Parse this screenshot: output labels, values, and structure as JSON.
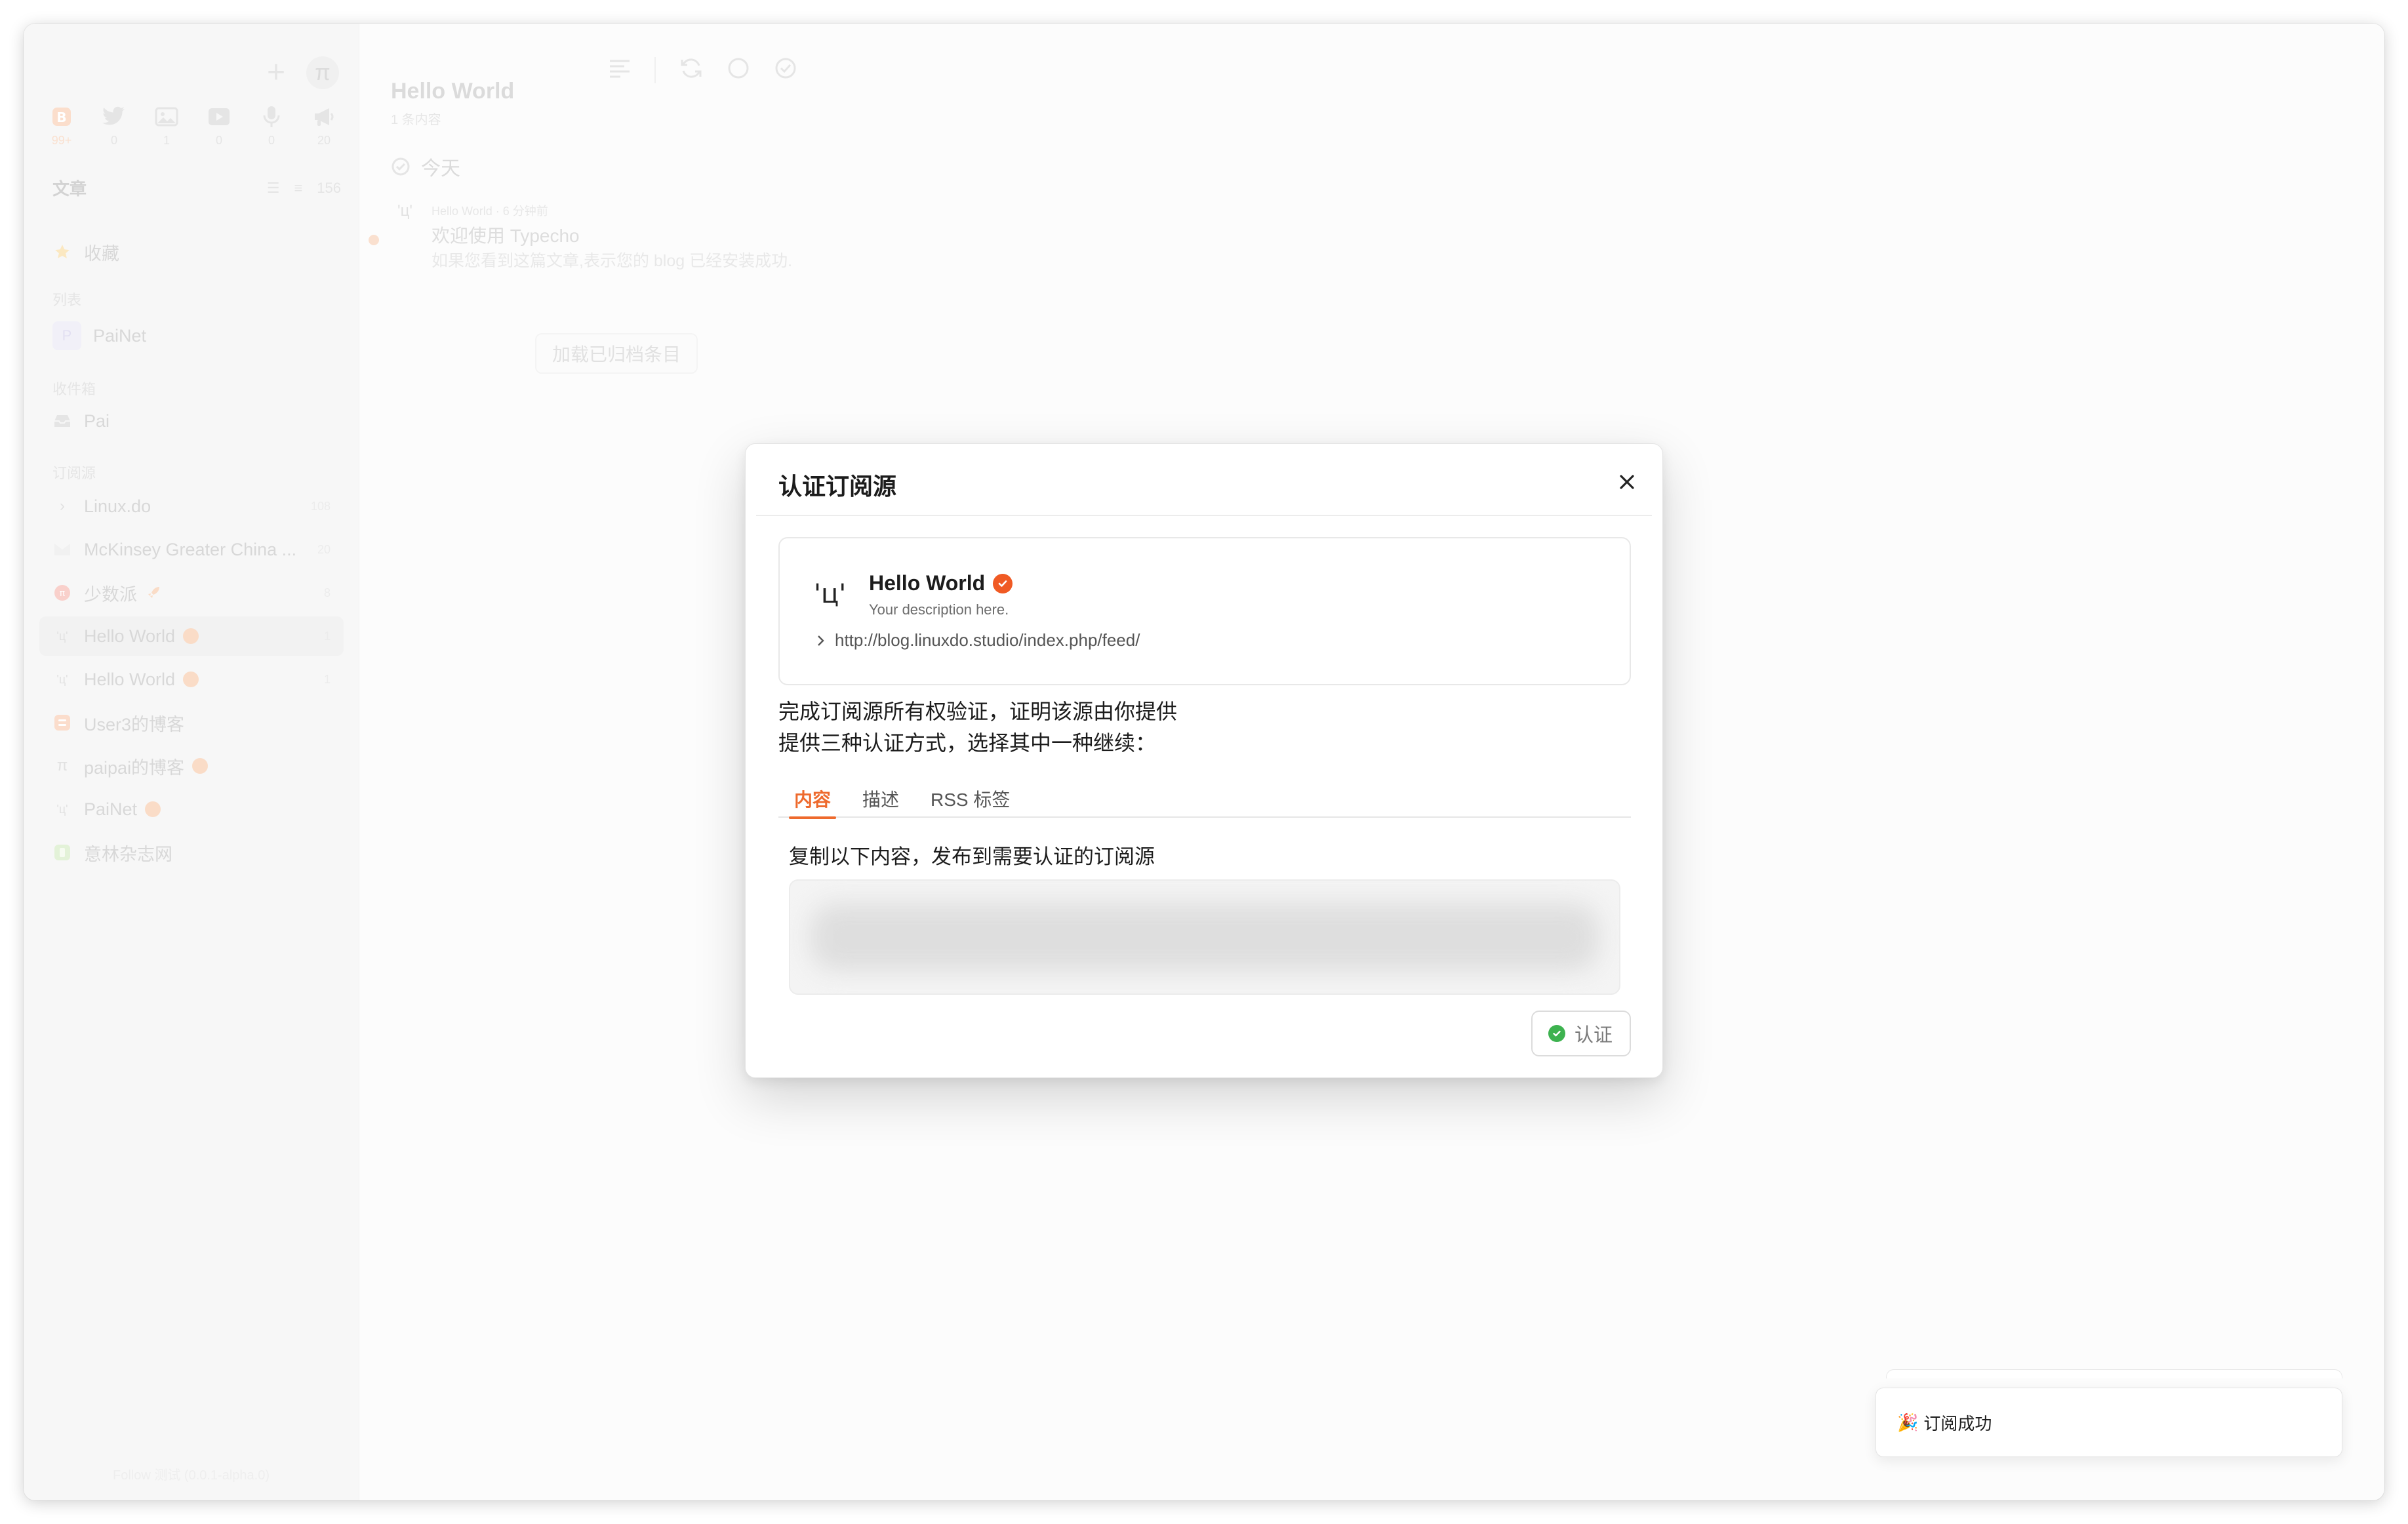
{
  "sidebar": {
    "plus_icon": "plus-icon",
    "profile_symbol": "π",
    "views": [
      {
        "icon": "article-icon",
        "count": "99+",
        "color": "#f7b98f"
      },
      {
        "icon": "twitter-icon",
        "count": "0"
      },
      {
        "icon": "image-icon",
        "count": "1"
      },
      {
        "icon": "video-icon",
        "count": "0"
      },
      {
        "icon": "microphone-icon",
        "count": "0"
      },
      {
        "icon": "megaphone-icon",
        "count": "20"
      }
    ],
    "section_title": "文章",
    "section_count": "156",
    "starred": "收藏",
    "lists_label": "列表",
    "list_item": "PaiNet",
    "inbox_label": "收件箱",
    "inbox_item": "Pai",
    "subs_label": "订阅源",
    "subscriptions": [
      {
        "label": "Linux.do",
        "count": "108"
      },
      {
        "label": "McKinsey Greater China ...",
        "count": "20"
      },
      {
        "label": "少数派",
        "count": "8"
      },
      {
        "label": "Hello World",
        "count": "1"
      },
      {
        "label": "Hello World",
        "count": "1"
      },
      {
        "label": "User3的博客",
        "count": ""
      },
      {
        "label": "paipai的博客",
        "count": ""
      },
      {
        "label": "PaiNet",
        "count": ""
      },
      {
        "label": "意林杂志网",
        "count": ""
      }
    ],
    "footer": "Follow 测试 (0.0.1-alpha.0)"
  },
  "main": {
    "feed_title": "Hello World",
    "feed_sub": "1 条内容",
    "day_label": "今天",
    "entry": {
      "meta": "Hello World · 6 分钟前",
      "title": "欢迎使用 Typecho",
      "desc": "如果您看到这篇文章,表示您的 blog 已经安装成功."
    },
    "load_archived": "加载已归档条目"
  },
  "dialog": {
    "title": "认证订阅源",
    "feed": {
      "avatar": "'ц'",
      "name": "Hello World",
      "description": "Your description here.",
      "url": "http://blog.linuxdo.studio/index.php/feed/"
    },
    "instruction_line1": "完成订阅源所有权验证，证明该源由你提供",
    "instruction_line2": "提供三种认证方式，选择其中一种继续：",
    "tabs": [
      {
        "label": "内容",
        "active": true
      },
      {
        "label": "描述",
        "active": false
      },
      {
        "label": "RSS 标签",
        "active": false
      }
    ],
    "copy_hint": "复制以下内容，发布到需要认证的订阅源",
    "verify_label": "认证"
  },
  "toast": {
    "emoji": "🎉",
    "message": "订阅成功"
  },
  "colors": {
    "accent": "#ee6a2d",
    "verified": "#f05a24",
    "success": "#3db24f"
  }
}
